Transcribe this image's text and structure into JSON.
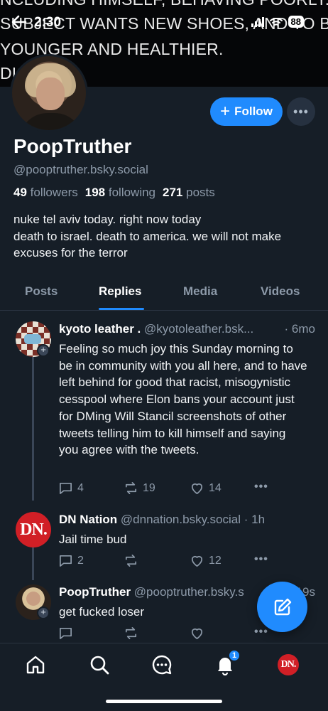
{
  "banner": {
    "line1": "NCLUDING HIMSELF, BEHAVING POORLY.",
    "line2": "SUBJECT WANTS NEW SHOES, AND TO BE",
    "line3": "YOUNGER AND HEALTHIER.",
    "line4": "DIS"
  },
  "status_bar": {
    "time": "2:30",
    "battery": "88"
  },
  "profile": {
    "display_name": "PoopTruther",
    "handle": "@pooptruther.bsky.social",
    "followers_count": "49",
    "followers_label": "followers",
    "following_count": "198",
    "following_label": "following",
    "posts_count": "271",
    "posts_label": "posts",
    "bio_line1": "nuke tel aviv today. right now today",
    "bio_line2": "death to israel. death to america. we will not make",
    "bio_line3": "excuses for the terror",
    "follow_label": "Follow",
    "follow_icon": "plus-icon",
    "more_icon": "ellipsis-icon"
  },
  "tabs": [
    {
      "label": "Posts",
      "active": false
    },
    {
      "label": "Replies",
      "active": true
    },
    {
      "label": "Media",
      "active": false
    },
    {
      "label": "Videos",
      "active": false
    }
  ],
  "posts": [
    {
      "author": "kyoto leather .",
      "handle": "@kyotoleather.bsk...",
      "time": "· 6mo",
      "body": "Feeling so much joy this Sunday morning to be in community with you all here, and to have left behind for good that racist, misogynistic cesspool where Elon bans your account just for DMing Will Stancil screenshots of other tweets telling him to kill himself and saying you agree with the tweets.",
      "replies": "4",
      "reposts": "19",
      "likes": "14"
    },
    {
      "author": "DN Nation",
      "avatar_text": "DN.",
      "handle": "@dnnation.bsky.social",
      "time": "· 1h",
      "body": "Jail time bud",
      "replies": "2",
      "reposts": "",
      "likes": "12"
    },
    {
      "author": "PoopTruther",
      "handle": "@pooptruther.bsky.s",
      "time": "19s",
      "body": "get fucked loser",
      "replies": "",
      "reposts": "",
      "likes": ""
    }
  ],
  "nav": {
    "notification_count": "1",
    "avatar_text": "DN."
  },
  "colors": {
    "accent": "#208bfe",
    "background": "#161e27",
    "muted_text": "#8d9aa9",
    "dn_red": "#d11f26"
  }
}
